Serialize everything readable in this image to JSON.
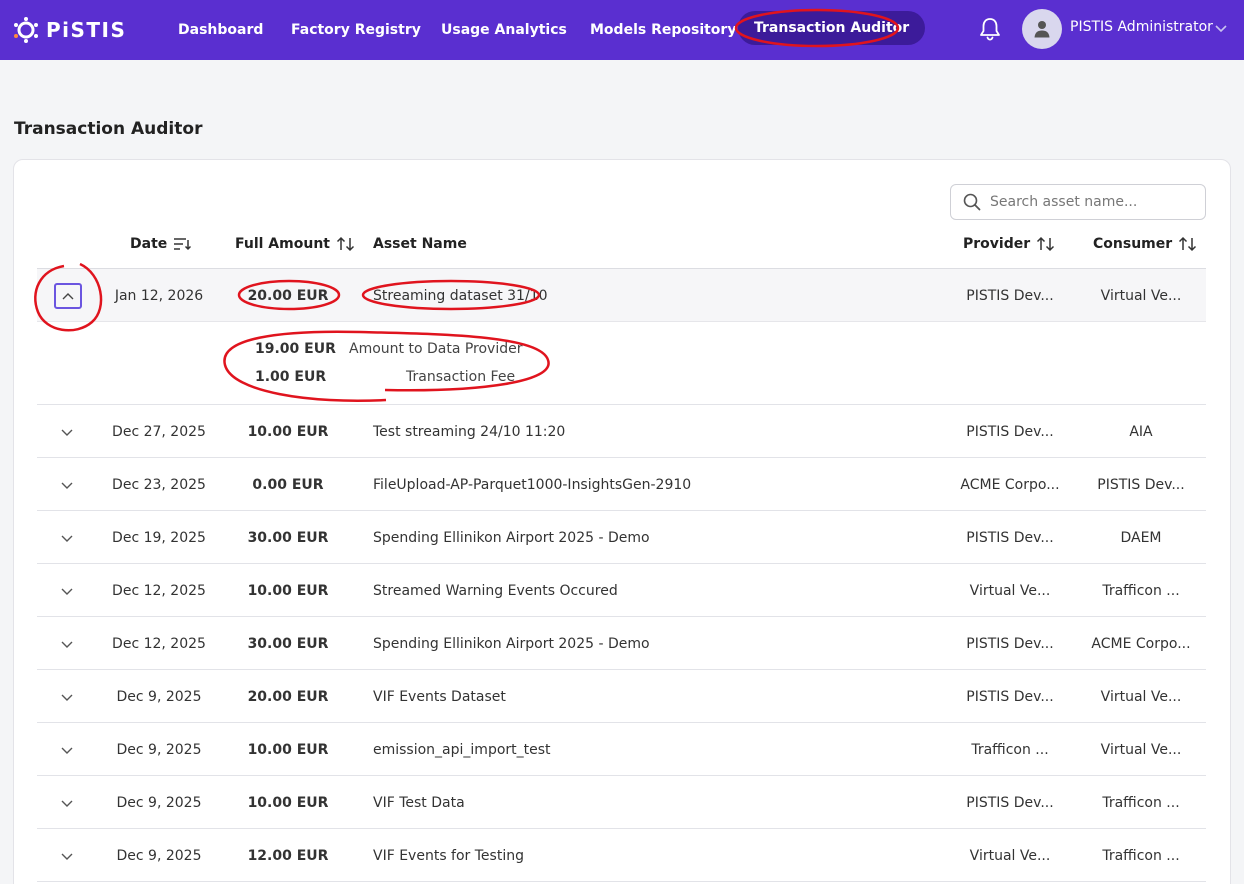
{
  "brand": {
    "name": "PiSTIS"
  },
  "nav": {
    "items": [
      {
        "label": "Dashboard"
      },
      {
        "label": "Factory Registry"
      },
      {
        "label": "Usage Analytics"
      },
      {
        "label": "Models Repository"
      },
      {
        "label": "Transaction Auditor",
        "active": true
      }
    ]
  },
  "user": {
    "name": "PISTIS Administrator"
  },
  "page": {
    "title": "Transaction Auditor"
  },
  "search": {
    "placeholder": "Search asset name..."
  },
  "table": {
    "columns": {
      "date": "Date",
      "amount": "Full Amount",
      "asset": "Asset Name",
      "provider": "Provider",
      "consumer": "Consumer"
    },
    "rows": [
      {
        "date": "Jan 12, 2026",
        "amount": "20.00 EUR",
        "asset": "Streaming dataset 31/10",
        "provider": "PISTIS Dev...",
        "consumer": "Virtual Ve...",
        "expanded": true
      },
      {
        "date": "Dec 27, 2025",
        "amount": "10.00 EUR",
        "asset": "Test streaming 24/10 11:20",
        "provider": "PISTIS Dev...",
        "consumer": "AIA"
      },
      {
        "date": "Dec 23, 2025",
        "amount": "0.00 EUR",
        "asset": "FileUpload-AP-Parquet1000-InsightsGen-2910",
        "provider": "ACME Corpo...",
        "consumer": "PISTIS Dev..."
      },
      {
        "date": "Dec 19, 2025",
        "amount": "30.00 EUR",
        "asset": "Spending Ellinikon Airport 2025 - Demo",
        "provider": "PISTIS Dev...",
        "consumer": "DAEM"
      },
      {
        "date": "Dec 12, 2025",
        "amount": "10.00 EUR",
        "asset": "Streamed Warning Events Occured",
        "provider": "Virtual Ve...",
        "consumer": "Trafficon ..."
      },
      {
        "date": "Dec 12, 2025",
        "amount": "30.00 EUR",
        "asset": "Spending Ellinikon Airport 2025 - Demo",
        "provider": "PISTIS Dev...",
        "consumer": "ACME Corpo..."
      },
      {
        "date": "Dec 9, 2025",
        "amount": "20.00 EUR",
        "asset": "VIF Events Dataset",
        "provider": "PISTIS Dev...",
        "consumer": "Virtual Ve..."
      },
      {
        "date": "Dec 9, 2025",
        "amount": "10.00 EUR",
        "asset": "emission_api_import_test",
        "provider": "Trafficon ...",
        "consumer": "Virtual Ve..."
      },
      {
        "date": "Dec 9, 2025",
        "amount": "10.00 EUR",
        "asset": "VIF Test Data",
        "provider": "PISTIS Dev...",
        "consumer": "Trafficon ..."
      },
      {
        "date": "Dec 9, 2025",
        "amount": "12.00 EUR",
        "asset": "VIF Events for Testing",
        "provider": "Virtual Ve...",
        "consumer": "Trafficon ..."
      }
    ],
    "breakdown": [
      {
        "amount": "19.00 EUR",
        "label": "Amount to Data Provider"
      },
      {
        "amount": "1.00 EUR",
        "label": "Transaction Fee"
      }
    ]
  },
  "colors": {
    "brand": "#5a2fd0",
    "active_nav": "#3c1b9a",
    "annotation": "#e0141e"
  }
}
